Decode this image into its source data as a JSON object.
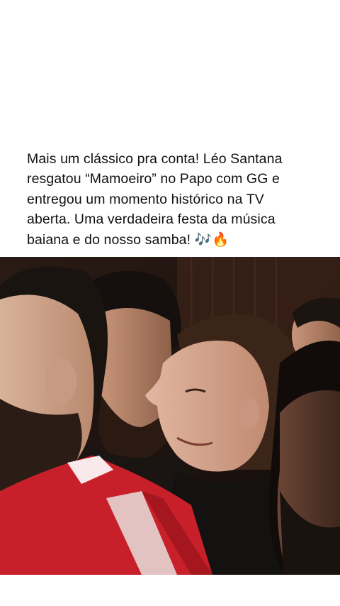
{
  "post": {
    "caption": "Mais um clássico pra conta! Léo Santana\nresgatou “Mamoeiro” no Papo com GG e\nentregou um momento histórico na TV\naberta. Uma verdadeira festa da música\nbaiana e do nosso samba! 🎶🔥"
  },
  "video": {
    "description_icon": "video-frame"
  },
  "colors": {
    "background": "#ffffff",
    "text": "#111111",
    "jersey_red": "#c8202a"
  }
}
